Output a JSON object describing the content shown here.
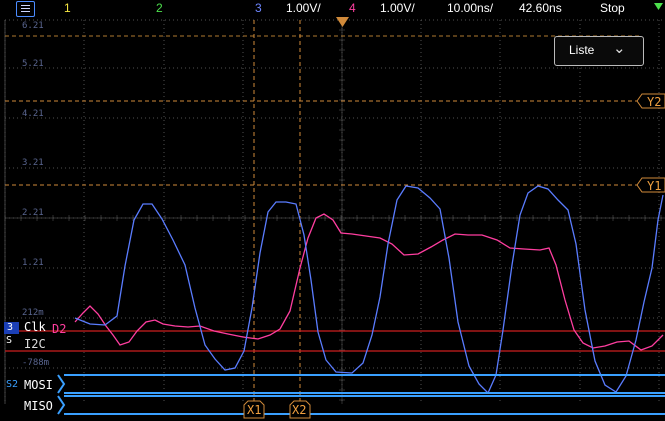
{
  "topbar": {
    "ch1": "1",
    "ch2": "2",
    "ch3": "3",
    "ch3_scale": "1.00V/",
    "ch4": "4",
    "ch4_scale": "1.00V/",
    "timebase": "10.00ns/",
    "delay": "42.60ns",
    "run_state": "Stop"
  },
  "list_dropdown": {
    "label": "Liste"
  },
  "y_scale_labels": [
    "6.21",
    "5.21",
    "4.21",
    "3.21",
    "2.21",
    "1.21",
    "212m",
    "-788m"
  ],
  "cursors": {
    "x1": "X1",
    "x2": "X2",
    "y1": "Y1",
    "y2": "Y2"
  },
  "bus_labels": {
    "clk": "Clk",
    "i2c": "I2C",
    "mosi": "MOSI",
    "miso": "MISO",
    "d2": "D2",
    "s2": "S2",
    "ch3_marker": "3",
    "s_marker": "S"
  },
  "colors": {
    "ch1": "#f5e642",
    "ch2": "#4de04d",
    "ch3": "#5a7cff",
    "ch4": "#ff3ea0",
    "cursor": "#f0a040",
    "bus": "#3aa0ff",
    "i2c_line": "#cc1f1f"
  }
}
